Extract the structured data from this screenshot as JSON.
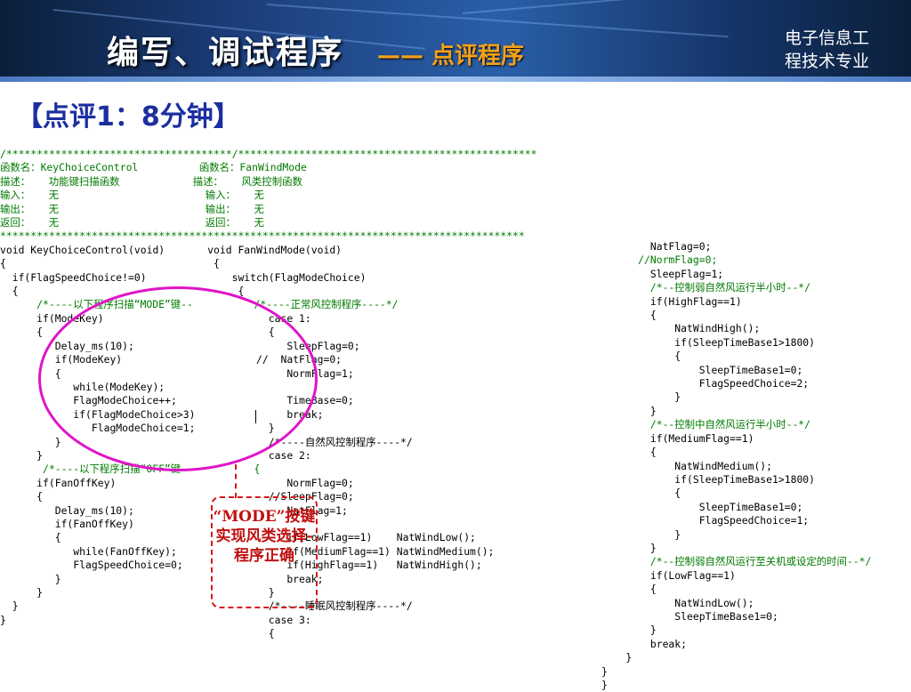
{
  "header": {
    "title": "编写、调试程序",
    "subtitle": "—— 点评程序",
    "org_line1": "电子信息工",
    "org_line2": "程技术专业"
  },
  "section_title": "【点评1：8分钟】",
  "callout_text": "“MODE”按键实现风类选择-程序正确",
  "left_code": [
    "/*************************************/*************************************************",
    "函数名：KeyChoiceControl          函数名：FanWindMode",
    "描述：   功能键扫描函数            描述：   风类控制函数",
    "输入：   无                        输入：   无",
    "输出：   无                        输出：   无",
    "返回：   无                        返回：   无",
    "**************************************************************************************",
    "void KeyChoiceControl(void)       void FanWindMode(void)",
    "{                                  {",
    "  if(FlagSpeedChoice!=0)              switch(FlagModeChoice)",
    "  {                                    {",
    "      /*----以下程序扫描“MODE”键--          /*----正常风控制程序----*/",
    "      if(ModeKey)                           case 1:",
    "      {                                     {",
    "         Delay_ms(10);                         SleepFlag=0;",
    "         if(ModeKey)                      //  NatFlag=0;",
    "         {                                     NormFlag=1;",
    "            while(ModeKey);",
    "            FlagModeChoice++;                  TimeBase=0;",
    "            if(FlagModeChoice>3)               break;",
    "               FlagModeChoice=1;            }",
    "         }                                  /*----自然风控制程序----*/",
    "      }                                     case 2:",
    "       /*----以下程序扫描“OFF”键--          {",
    "      if(FanOffKey)                            NormFlag=0;",
    "      {                                     //SleepFlag=0;",
    "         Delay_ms(10);                         NatFlag=1;",
    "         if(FanOffKey)",
    "         {                                     if(LowFlag==1)    NatWindLow();",
    "            while(FanOffKey);                  if(MediumFlag==1) NatWindMedium();",
    "            FlagSpeedChoice=0;                 if(HighFlag==1)   NatWindHigh();",
    "         }                                     break;",
    "      }                                     }",
    "  }                                         /*----睡眠风控制程序----*/",
    "}                                           case 3:",
    "                                            {"
  ],
  "right_code": [
    "        NatFlag=0;",
    "      //NormFlag=0;",
    "        SleepFlag=1;",
    "        /*--控制弱自然风运行半小时--*/",
    "        if(HighFlag==1)",
    "        {",
    "            NatWindHigh();",
    "            if(SleepTimeBase1>1800)",
    "            {",
    "                SleepTimeBase1=0;",
    "                FlagSpeedChoice=2;",
    "            }",
    "        }",
    "        /*--控制中自然风运行半小时--*/",
    "        if(MediumFlag==1)",
    "        {",
    "            NatWindMedium();",
    "            if(SleepTimeBase1>1800)",
    "            {",
    "                SleepTimeBase1=0;",
    "                FlagSpeedChoice=1;",
    "            }",
    "        }",
    "        /*--控制弱自然风运行至关机或设定的时间--*/",
    "        if(LowFlag==1)",
    "        {",
    "            NatWindLow();",
    "            SleepTimeBase1=0;",
    "        }",
    "        break;",
    "    }",
    "}",
    "}"
  ]
}
